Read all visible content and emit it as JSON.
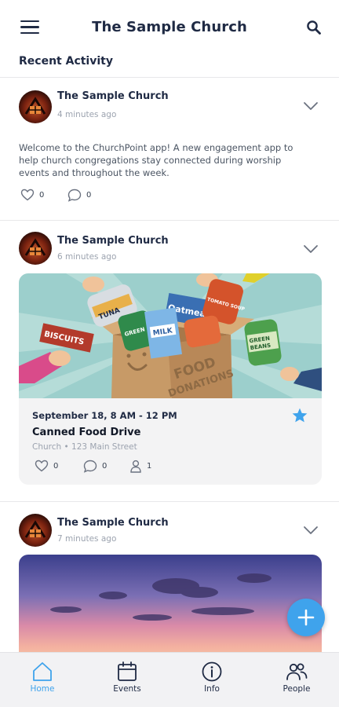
{
  "appbar": {
    "title": "The Sample Church",
    "menu_icon": "hamburger-menu-icon",
    "search_icon": "search-icon"
  },
  "section": {
    "title": "Recent Activity"
  },
  "posts": [
    {
      "author": "The Sample Church",
      "time": "4 minutes ago",
      "text": "Welcome to the ChurchPoint app! A new engagement app to help church congregations stay connected during worship events and throughout the week.",
      "likes": "0",
      "comments": "0"
    },
    {
      "author": "The Sample Church",
      "time": "6 minutes ago",
      "event": {
        "image_text": [
          "TUNA",
          "Oatmeal",
          "TOMATO SOUP",
          "BISCUITS",
          "GREEN BEANS",
          "MILK",
          "FOOD DONATIONS"
        ],
        "date": "September 18, 8 AM - 12 PM",
        "name": "Canned Food Drive",
        "location": "Church • 123 Main Street",
        "likes": "0",
        "comments": "0",
        "attendees": "1",
        "starred": true
      }
    },
    {
      "author": "The Sample Church",
      "time": "7 minutes ago"
    }
  ],
  "tabs": [
    {
      "label": "Home",
      "icon": "home-icon",
      "active": true
    },
    {
      "label": "Events",
      "icon": "calendar-icon",
      "active": false
    },
    {
      "label": "Info",
      "icon": "info-icon",
      "active": false
    },
    {
      "label": "People",
      "icon": "people-icon",
      "active": false
    }
  ],
  "colors": {
    "accent": "#3fa3ec",
    "navy": "#1f2a44",
    "muted": "#9ca3af",
    "card_bg": "#f3f3f4"
  }
}
